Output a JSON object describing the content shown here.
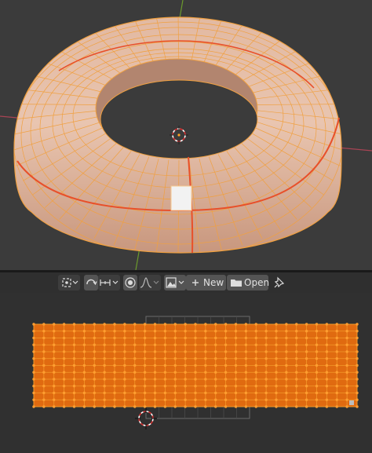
{
  "viewport_3d": {
    "object": "torus",
    "mode": "edit-mode-all-selected",
    "colors": {
      "background": "#3b3b3b",
      "face_fill": "#e8c0a8",
      "wire": "#f0a040",
      "seam": "#e8502a",
      "active_face": "#f2f2f2",
      "x_axis": "#a84454",
      "y_axis": "#6b9a2c"
    },
    "cursor_icon": "3d-cursor-icon"
  },
  "uv_header": {
    "pivot_menu": {
      "icon": "pivot-point-icon",
      "chevron": "chevron-down-icon"
    },
    "sync_toggle": {
      "icon": "uv-sync-selection-icon"
    },
    "snap_menu": {
      "icon": "snap-increment-icon",
      "chevron": "chevron-down-icon"
    },
    "proportional_toggle": {
      "icon": "proportional-editing-icon"
    },
    "falloff_menu": {
      "icon": "falloff-curve-icon",
      "chevron": "chevron-down-icon"
    },
    "image_browse": {
      "icon": "image-browse-icon",
      "chevron": "chevron-down-icon"
    },
    "new_button": {
      "label": "New",
      "icon": "plus-icon"
    },
    "open_button": {
      "label": "Open",
      "icon": "folder-icon"
    },
    "pin_button": {
      "icon": "pin-icon"
    }
  },
  "uv_editor": {
    "colors": {
      "background": "#303030",
      "uv_face_fill": "#e06a10",
      "uv_wire": "#f29a2a",
      "uv_vertex": "#ff9d30",
      "image_bounds": "#6a6a6a"
    },
    "grid_columns": 32,
    "grid_rows": 12,
    "cursor_icon": "2d-cursor-icon"
  }
}
